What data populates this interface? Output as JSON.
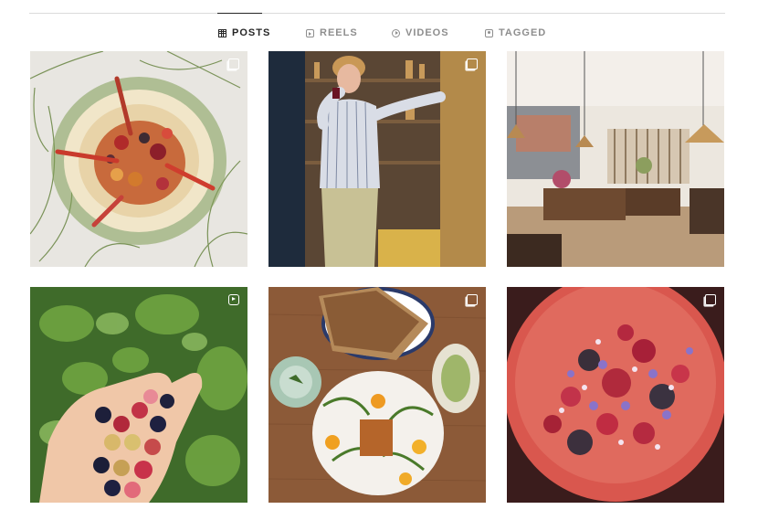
{
  "tabs": [
    {
      "label": "POSTS",
      "icon": "grid-icon",
      "active": true
    },
    {
      "label": "REELS",
      "icon": "reels-icon",
      "active": false
    },
    {
      "label": "VIDEOS",
      "icon": "video-play-icon",
      "active": false
    },
    {
      "label": "TAGGED",
      "icon": "tagged-user-icon",
      "active": false
    }
  ],
  "posts": [
    {
      "type": "carousel",
      "badge_icon": "multiple-images-icon",
      "subject": "tomato-salad-bowl-with-thyme"
    },
    {
      "type": "carousel",
      "badge_icon": "multiple-images-icon",
      "subject": "man-drinking-wine-in-kitchen"
    },
    {
      "type": "image",
      "badge_icon": "",
      "subject": "restaurant-dining-room-interior"
    },
    {
      "type": "reel",
      "badge_icon": "reel-icon",
      "subject": "hand-holding-berries"
    },
    {
      "type": "carousel",
      "badge_icon": "multiple-images-icon",
      "subject": "bread-and-fish-dishes-on-table"
    },
    {
      "type": "carousel",
      "badge_icon": "multiple-images-icon",
      "subject": "red-plate-with-berries-and-flowers"
    }
  ],
  "colors": {
    "active_tab": "#262626",
    "inactive_tab": "#8e8e8e",
    "divider": "#dbdbdb"
  }
}
